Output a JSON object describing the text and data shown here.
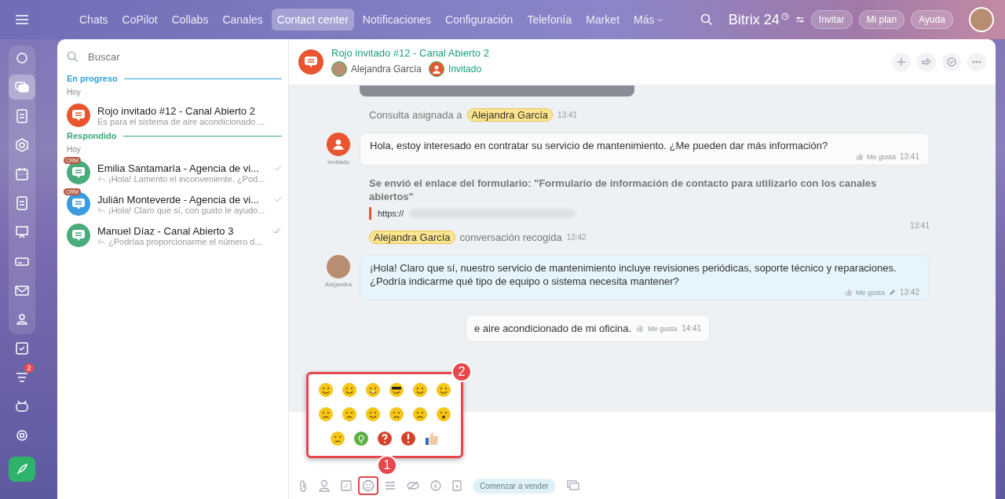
{
  "topbar": {
    "tabs": [
      {
        "label": "Chats",
        "selected": false
      },
      {
        "label": "CoPilot",
        "selected": false
      },
      {
        "label": "Collabs",
        "selected": false
      },
      {
        "label": "Canales",
        "selected": false
      },
      {
        "label": "Contact center",
        "selected": true
      },
      {
        "label": "Notificaciones",
        "selected": false
      },
      {
        "label": "Configuración",
        "selected": false
      },
      {
        "label": "Telefonía",
        "selected": false
      },
      {
        "label": "Market",
        "selected": false
      },
      {
        "label": "Más",
        "selected": false
      }
    ],
    "logo": "Bitrix 24",
    "buttons": [
      "Invitar",
      "Mi plan",
      "Ayuda"
    ]
  },
  "rail": [
    {
      "selected": false
    },
    {
      "selected": true
    },
    {
      "selected": false
    },
    {
      "selected": false
    },
    {
      "selected": false
    },
    {
      "selected": false
    },
    {
      "selected": false
    },
    {
      "selected": false
    },
    {
      "selected": false
    },
    {
      "selected": false
    },
    {
      "selected": false
    },
    {
      "selected": false,
      "badge": "2"
    },
    {
      "selected": false
    },
    {
      "selected": false
    }
  ],
  "panel": {
    "search": {
      "placeholder": "Buscar"
    },
    "sections": [
      {
        "title": "En progreso",
        "color": "#2fa6d1",
        "date": "Hoy",
        "chats": [
          {
            "name": "Rojo invitado #12 - Canal Abierto 2",
            "preview": "Es para el sistema de aire acondicionado ...",
            "color": "#e8552f",
            "replied": false
          }
        ]
      },
      {
        "title": "Respondido",
        "color": "#3aa874",
        "date": "Hoy",
        "chats": [
          {
            "name": "Emilia Santamaría - Agencia de vi...",
            "preview": "¡Hola! Lamento el inconveniente. ¿Pod...",
            "color": "#4aab7b",
            "badge": "CRM",
            "replied": true,
            "read": false
          },
          {
            "name": "Julián Monteverde - Agencia de vi...",
            "preview": "¡Hola! Claro que sí, con gusto le ayudo...",
            "color": "#3a9be0",
            "badge": "CRM",
            "replied": true,
            "read": false
          },
          {
            "name": "Manuel Díaz - Canal Abierto 3",
            "preview": "¿Podríaa proporcionarme el número d...",
            "color": "#4aab7b",
            "replied": true,
            "read": true
          }
        ]
      }
    ]
  },
  "chat": {
    "title": "Rojo invitado #12 - Canal Abierto 2",
    "members": [
      {
        "name": "Alejandra García",
        "kind": "operator"
      },
      {
        "name": "Invitado",
        "kind": "guest"
      }
    ],
    "messages": [
      {
        "kind": "system",
        "name": "Alejandra García",
        "text": "Consulta asignada a",
        "name_first": false,
        "time": "13:41"
      },
      {
        "kind": "incoming",
        "author": "Invitado",
        "text": "Hola, estoy interesado en contratar su servicio de mantenimiento. ¿Me pueden dar más información?",
        "like": "Me gusta",
        "time": "13:41"
      },
      {
        "kind": "form",
        "text": "Se envió el enlace del formulario: \"Formulario de información de contacto para utilizarlo con los canales abiertos\"",
        "link": "https://",
        "time": "13:41"
      },
      {
        "kind": "system",
        "name": "Alejandra García",
        "text": "conversación recogida",
        "name_first": true,
        "time": "13:42"
      },
      {
        "kind": "outgoing",
        "author": "Alejandra",
        "lines": [
          "¡Hola! Claro que sí, nuestro servicio de mantenimiento incluye revisiones periódicas, soporte técnico y reparaciones.",
          "¿Podría indicarme qué tipo de equipo o sistema necesita mantener?"
        ],
        "like": "Me gusta",
        "edited": true,
        "time": "13:42"
      },
      {
        "kind": "partial",
        "text": "e aire acondicionado de mi oficina.",
        "like": "Me gusta",
        "time": "14:41"
      }
    ],
    "sell_button": "Comenzar a vender",
    "callouts": [
      "1",
      "2"
    ]
  }
}
